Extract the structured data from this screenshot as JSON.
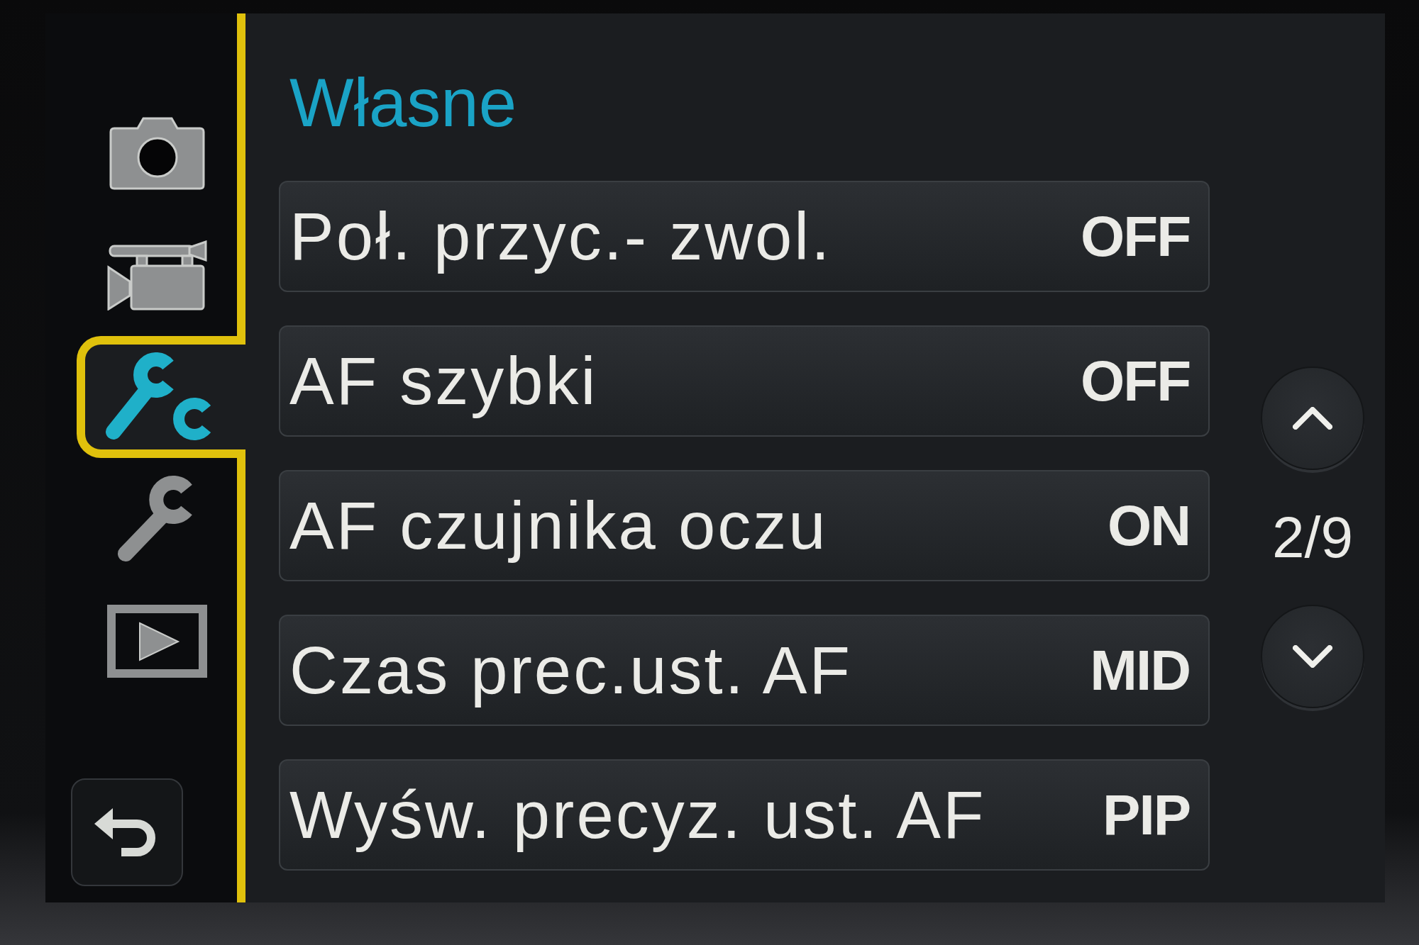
{
  "screen_title": "Własne",
  "sidebar": {
    "tabs": [
      {
        "kind": "photo",
        "selected": false
      },
      {
        "kind": "video",
        "selected": false
      },
      {
        "kind": "custom",
        "selected": true
      },
      {
        "kind": "setup",
        "selected": false
      },
      {
        "kind": "playback",
        "selected": false
      }
    ]
  },
  "menu_items": [
    {
      "label": "Poł. przyc.- zwol.",
      "value": "OFF"
    },
    {
      "label": "AF szybki",
      "value": "OFF"
    },
    {
      "label": "AF czujnika oczu",
      "value": "ON"
    },
    {
      "label": "Czas prec.ust. AF",
      "value": "MID"
    },
    {
      "label": "Wyśw. precyz. ust. AF",
      "value": "PIP"
    }
  ],
  "pager": {
    "page": "2/9"
  }
}
